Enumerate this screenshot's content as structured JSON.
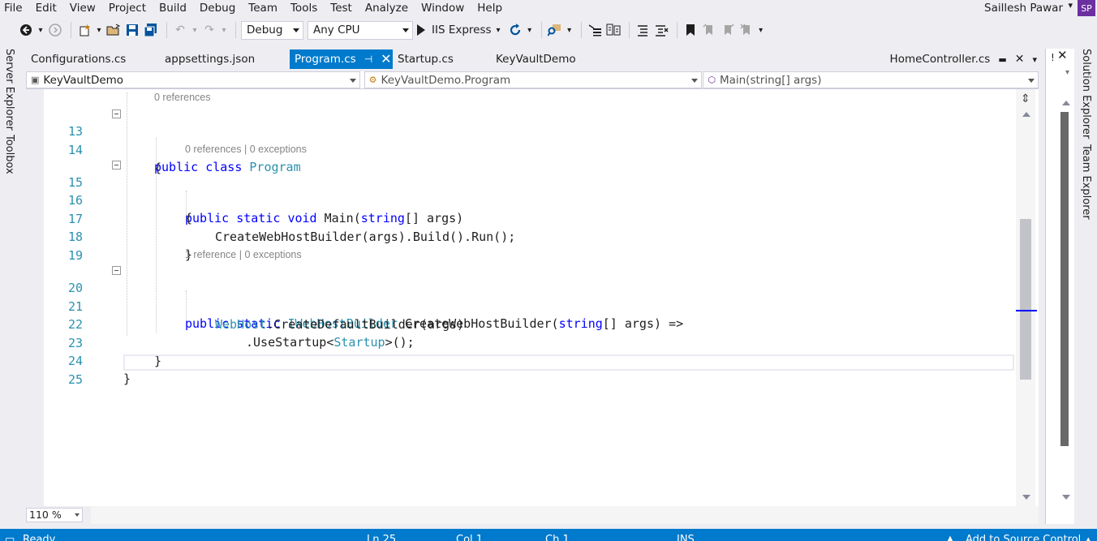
{
  "menu": [
    "File",
    "Edit",
    "View",
    "Project",
    "Build",
    "Debug",
    "Team",
    "Tools",
    "Test",
    "Analyze",
    "Window",
    "Help"
  ],
  "user": {
    "name": "Saillesh Pawar",
    "initials": "SP"
  },
  "toolbar": {
    "config": "Debug",
    "platform": "Any CPU",
    "run_label": "IIS Express"
  },
  "side_tabs": {
    "left": [
      "Server Explorer",
      "Toolbox"
    ],
    "right": [
      "Solution Explorer",
      "Team Explorer"
    ]
  },
  "tabs": [
    {
      "label": "Configurations.cs"
    },
    {
      "label": "appsettings.json"
    },
    {
      "label": "Program.cs",
      "active": true
    },
    {
      "label": "Startup.cs"
    },
    {
      "label": "KeyVaultDemo"
    }
  ],
  "right_tab": {
    "label": "HomeController.cs"
  },
  "navbar": {
    "project": "KeyVaultDemo",
    "type": "KeyVaultDemo.Program",
    "member": "Main(string[] args)"
  },
  "code": {
    "lens_top": "0 references",
    "lens_main_refs": "0 references",
    "lens_main_exc": "0 exceptions",
    "lens_builder_refs": "1 reference",
    "lens_builder_exc": "0 exceptions",
    "line_numbers": [
      "13",
      "14",
      "15",
      "16",
      "17",
      "18",
      "19",
      "20",
      "21",
      "22",
      "23",
      "24",
      "25"
    ]
  },
  "zoom": "110 %",
  "status": {
    "ready": "Ready",
    "ln": "Ln 25",
    "col": "Col 1",
    "ch": "Ch 1",
    "mode": "INS",
    "source_control": "Add to Source Control"
  }
}
